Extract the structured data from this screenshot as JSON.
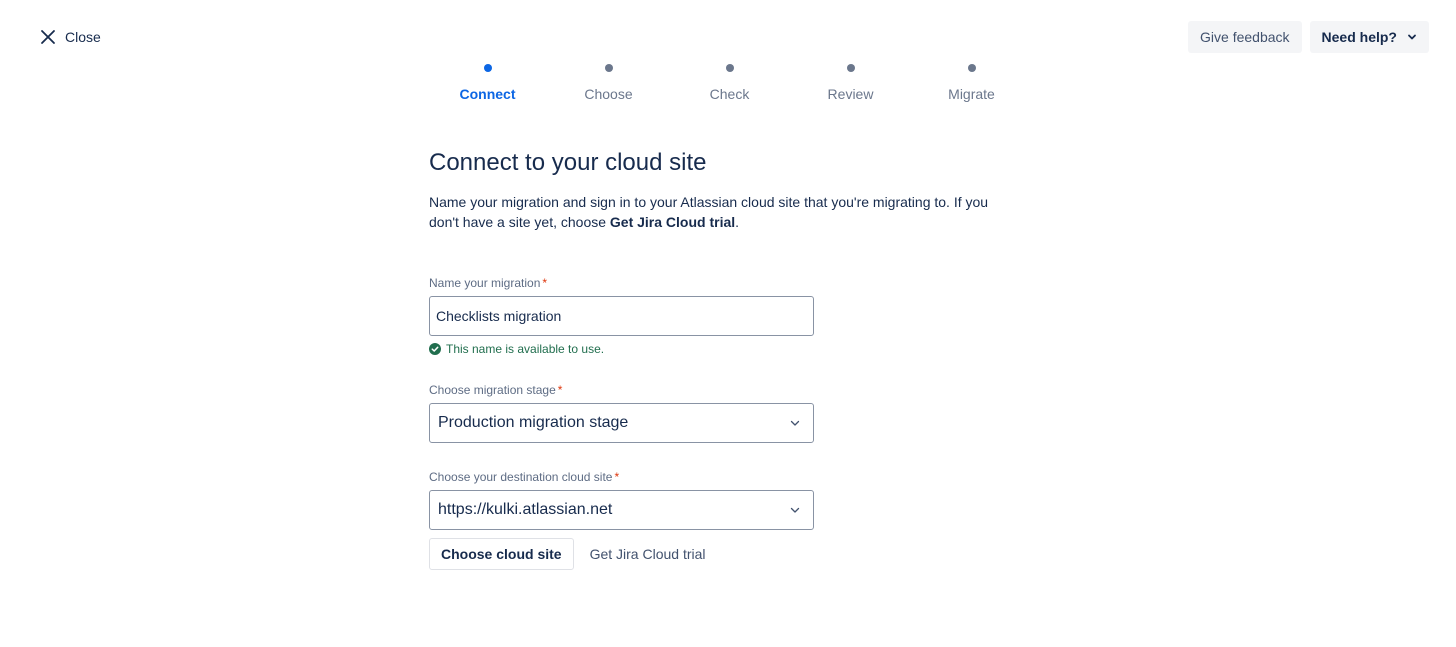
{
  "header": {
    "close_label": "Close",
    "feedback_label": "Give feedback",
    "help_label": "Need help?"
  },
  "stepper": {
    "steps": [
      {
        "label": "Connect",
        "active": true
      },
      {
        "label": "Choose",
        "active": false
      },
      {
        "label": "Check",
        "active": false
      },
      {
        "label": "Review",
        "active": false
      },
      {
        "label": "Migrate",
        "active": false
      }
    ]
  },
  "main": {
    "title": "Connect to your cloud site",
    "description_prefix": "Name your migration and sign in to your Atlassian cloud site that you're migrating to. If you don't have a site yet, choose ",
    "description_bold": "Get Jira Cloud trial",
    "description_suffix": "."
  },
  "form": {
    "migration_name": {
      "label": "Name your migration",
      "required_mark": "*",
      "value": "Checklists migration",
      "validation_message": "This name is available to use."
    },
    "migration_stage": {
      "label": "Choose migration stage",
      "required_mark": "*",
      "selected": "Production migration stage"
    },
    "destination_site": {
      "label": "Choose your destination cloud site",
      "required_mark": "*",
      "selected": "https://kulki.atlassian.net"
    }
  },
  "actions": {
    "choose_site_label": "Choose cloud site",
    "trial_label": "Get Jira Cloud trial"
  },
  "colors": {
    "accent": "#0c66e4",
    "success": "#216e4e",
    "required": "#de350b"
  }
}
